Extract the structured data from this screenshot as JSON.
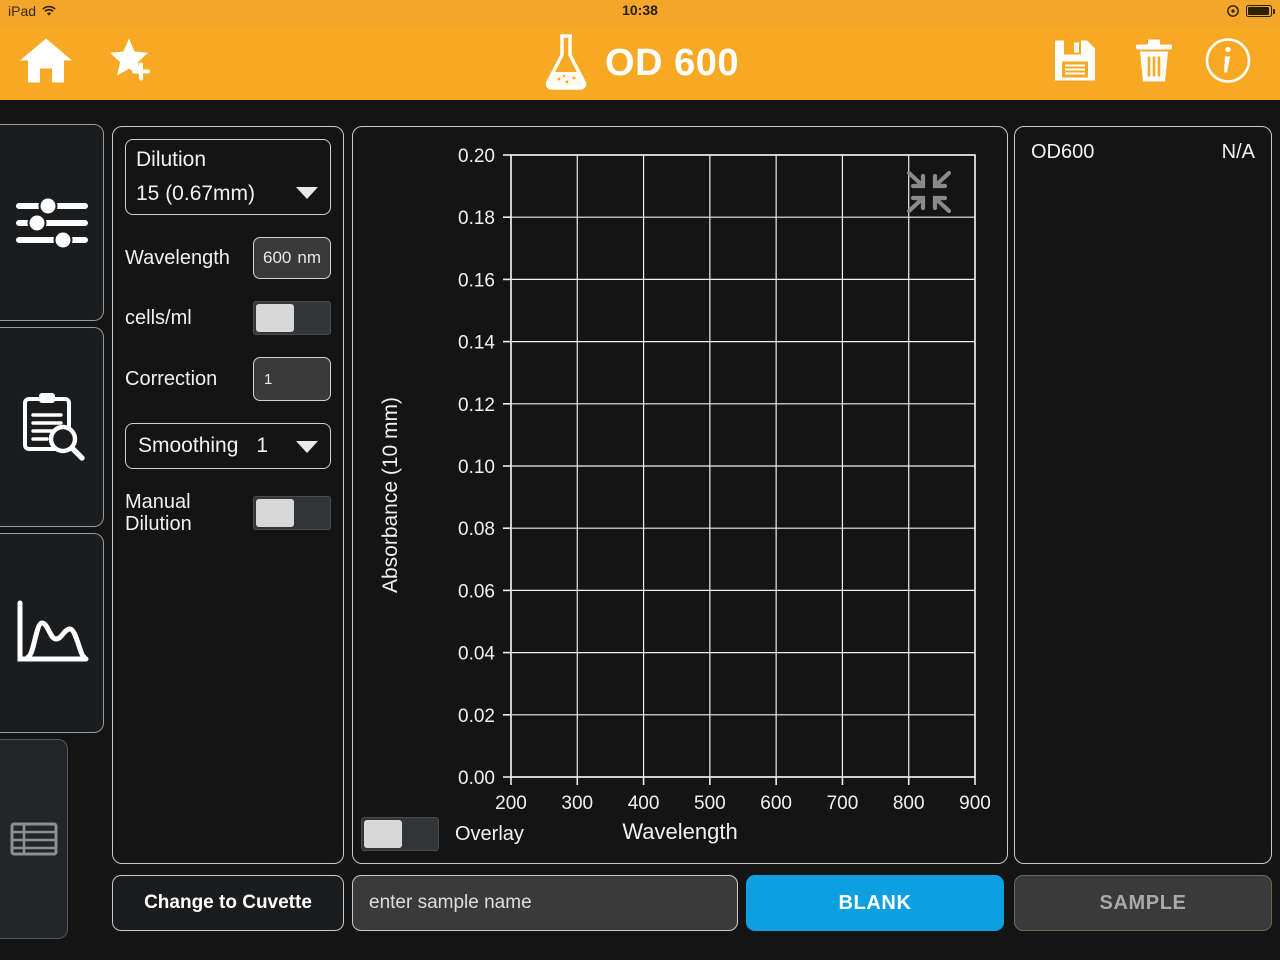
{
  "statusbar": {
    "device": "iPad",
    "wifi_icon": "wifi-icon",
    "time": "10:38",
    "rotation_lock_icon": "rotation-lock-icon",
    "battery_icon": "battery-icon"
  },
  "appbar": {
    "title": "OD 600",
    "flask_icon": "flask-icon",
    "home_icon": "home-icon",
    "favorite_icon": "star-add-icon",
    "save_icon": "save-icon",
    "delete_icon": "trash-icon",
    "info_icon": "info-icon"
  },
  "sidebar": {
    "items": [
      {
        "name": "settings-sliders",
        "icon": "sliders-icon",
        "active": true
      },
      {
        "name": "sample-inspect",
        "icon": "clipboard-search-icon",
        "active": true
      },
      {
        "name": "spectrum-chart",
        "icon": "curve-chart-icon",
        "active": true
      },
      {
        "name": "data-table",
        "icon": "table-icon",
        "active": false
      }
    ]
  },
  "controls": {
    "dilution": {
      "label": "Dilution",
      "value": "15 (0.67mm)"
    },
    "wavelength": {
      "label": "Wavelength",
      "value": "600",
      "unit": "nm"
    },
    "cells_per_ml": {
      "label": "cells/ml",
      "state": "off"
    },
    "correction": {
      "label": "Correction",
      "value": "1"
    },
    "smoothing": {
      "label": "Smoothing",
      "value": "1"
    },
    "manual_dilution": {
      "label": "Manual Dilution",
      "state": "off"
    }
  },
  "chart_data": {
    "type": "line",
    "title": "",
    "xlabel": "Wavelength",
    "ylabel": "Absorbance (10 mm)",
    "xlim": [
      200,
      900
    ],
    "ylim": [
      0.0,
      0.2
    ],
    "xticks": [
      "200",
      "300",
      "400",
      "500",
      "600",
      "700",
      "800",
      "900"
    ],
    "yticks": [
      "0.00",
      "0.02",
      "0.04",
      "0.06",
      "0.08",
      "0.10",
      "0.12",
      "0.14",
      "0.16",
      "0.18",
      "0.20"
    ],
    "grid": true,
    "legend": "none",
    "series": [],
    "note": "empty plot - no spectrum traced yet"
  },
  "chart_panel": {
    "collapse_icon": "collapse-arrows-icon",
    "overlay": {
      "label": "Overlay",
      "state": "off"
    }
  },
  "results": {
    "rows": [
      {
        "name": "OD600",
        "value": "N/A"
      }
    ]
  },
  "bottombar": {
    "cuvette_button": "Change to Cuvette",
    "sample_name_placeholder": "enter sample name",
    "blank_button": "BLANK",
    "sample_button": "SAMPLE"
  },
  "colors": {
    "accent_orange": "#F7A923",
    "blank_blue": "#0E9FE0",
    "panel_bg": "#141414",
    "border": "#c9c9c9"
  }
}
